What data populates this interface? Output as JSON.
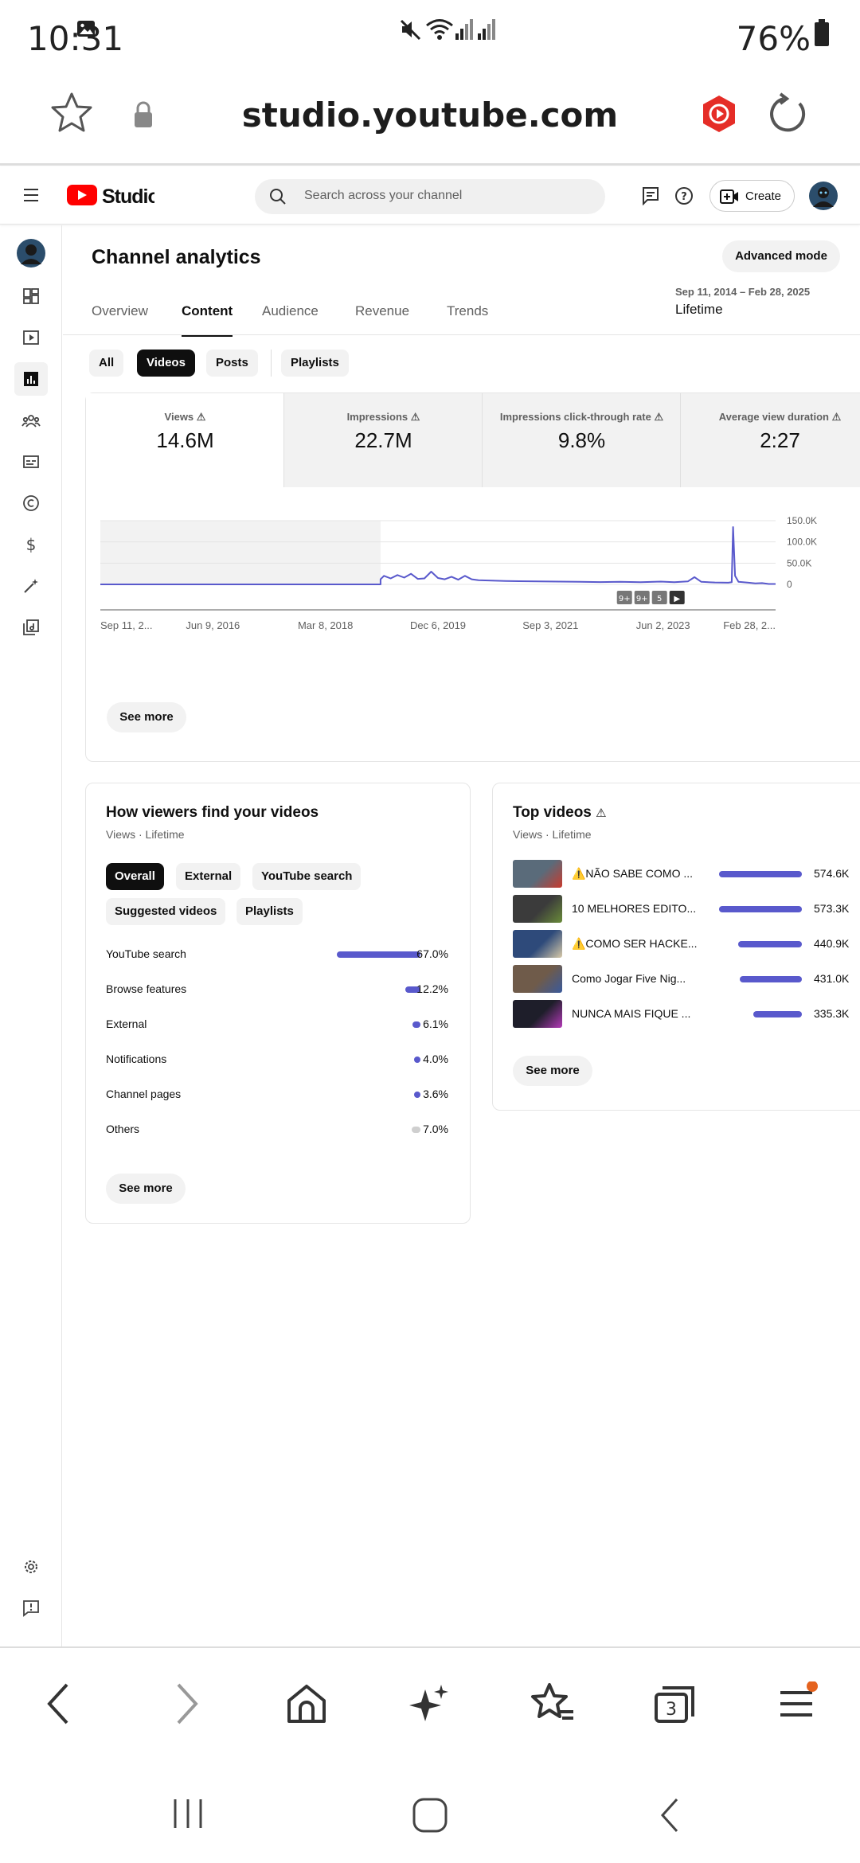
{
  "status_bar": {
    "time": "10:31",
    "battery": "76%"
  },
  "browser": {
    "url": "studio.youtube.com",
    "tabs_count": "3"
  },
  "header": {
    "search_placeholder": "Search across your channel",
    "create_label": "Create"
  },
  "page": {
    "title": "Channel analytics",
    "advanced_mode": "Advanced mode",
    "date_range": "Sep 11, 2014 – Feb 28, 2025",
    "date_label": "Lifetime",
    "tabs": [
      "Overview",
      "Content",
      "Audience",
      "Revenue",
      "Trends"
    ],
    "active_tab": "Content",
    "chips": [
      "All",
      "Videos",
      "Posts",
      "Playlists"
    ],
    "active_chip": "Videos"
  },
  "metrics": [
    {
      "label": "Views",
      "value": "14.6M"
    },
    {
      "label": "Impressions",
      "value": "22.7M"
    },
    {
      "label": "Impressions click-through rate",
      "value": "9.8%"
    },
    {
      "label": "Average view duration",
      "value": "2:27"
    }
  ],
  "chart_data": {
    "type": "line",
    "series": [
      {
        "values": [
          [
            0.0,
            0
          ],
          [
            0.415,
            0
          ],
          [
            0.415,
            12000
          ],
          [
            0.42,
            20000
          ],
          [
            0.43,
            14000
          ],
          [
            0.44,
            22000
          ],
          [
            0.45,
            16000
          ],
          [
            0.46,
            25000
          ],
          [
            0.47,
            13000
          ],
          [
            0.48,
            14000
          ],
          [
            0.49,
            30000
          ],
          [
            0.5,
            15000
          ],
          [
            0.51,
            12000
          ],
          [
            0.52,
            18000
          ],
          [
            0.53,
            11000
          ],
          [
            0.54,
            20000
          ],
          [
            0.55,
            12000
          ],
          [
            0.56,
            10000
          ],
          [
            0.58,
            9000
          ],
          [
            0.6,
            8000
          ],
          [
            0.62,
            7500
          ],
          [
            0.65,
            7000
          ],
          [
            0.68,
            6500
          ],
          [
            0.71,
            6000
          ],
          [
            0.74,
            5500
          ],
          [
            0.77,
            6000
          ],
          [
            0.8,
            5000
          ],
          [
            0.83,
            6500
          ],
          [
            0.85,
            5000
          ],
          [
            0.87,
            7000
          ],
          [
            0.88,
            17000
          ],
          [
            0.89,
            6000
          ],
          [
            0.91,
            4500
          ],
          [
            0.93,
            4000
          ],
          [
            0.935,
            5000
          ],
          [
            0.937,
            135000
          ],
          [
            0.94,
            20000
          ],
          [
            0.945,
            6000
          ],
          [
            0.96,
            4000
          ],
          [
            0.97,
            2500
          ],
          [
            0.98,
            3000
          ],
          [
            0.99,
            1000
          ],
          [
            1.0,
            1000
          ]
        ]
      }
    ],
    "x_tick_labels": [
      "Sep 11, 2...",
      "Jun 9, 2016",
      "Mar 8, 2018",
      "Dec 6, 2019",
      "Sep 3, 2021",
      "Jun 2, 2023",
      "Feb 28, 2..."
    ],
    "y_tick_labels": [
      "150.0K",
      "100.0K",
      "50.0K",
      "0"
    ],
    "ylim": [
      0,
      150000
    ],
    "markers": [
      "9+",
      "9+",
      "5",
      "▶"
    ],
    "grid": true
  },
  "see_more": "See more",
  "traffic": {
    "title": "How viewers find your videos",
    "subtitle": "Views · Lifetime",
    "chips": [
      "Overall",
      "External",
      "YouTube search",
      "Suggested videos",
      "Playlists"
    ],
    "rows": [
      {
        "label": "YouTube search",
        "value": "67.0%",
        "share": 0.67
      },
      {
        "label": "Browse features",
        "value": "12.2%",
        "share": 0.122
      },
      {
        "label": "External",
        "value": "6.1%",
        "share": 0.061
      },
      {
        "label": "Notifications",
        "value": "4.0%",
        "share": 0.04
      },
      {
        "label": "Channel pages",
        "value": "3.6%",
        "share": 0.036
      },
      {
        "label": "Others",
        "value": "7.0%",
        "share": 0.07
      }
    ]
  },
  "top_videos": {
    "title": "Top videos",
    "subtitle": "Views · Lifetime",
    "rows": [
      {
        "title": "⚠️NÃO SABE COMO ...",
        "views": "574.6K",
        "share": 1.0
      },
      {
        "title": "10 MELHORES EDITO...",
        "views": "573.3K",
        "share": 0.998
      },
      {
        "title": "⚠️COMO SER HACKE...",
        "views": "440.9K",
        "share": 0.767
      },
      {
        "title": "Como Jogar Five Nig...",
        "views": "431.0K",
        "share": 0.75
      },
      {
        "title": "NUNCA MAIS FIQUE ...",
        "views": "335.3K",
        "share": 0.583
      }
    ]
  },
  "colors": {
    "accent": "#5959cc",
    "brand_red": "#ff0000"
  }
}
